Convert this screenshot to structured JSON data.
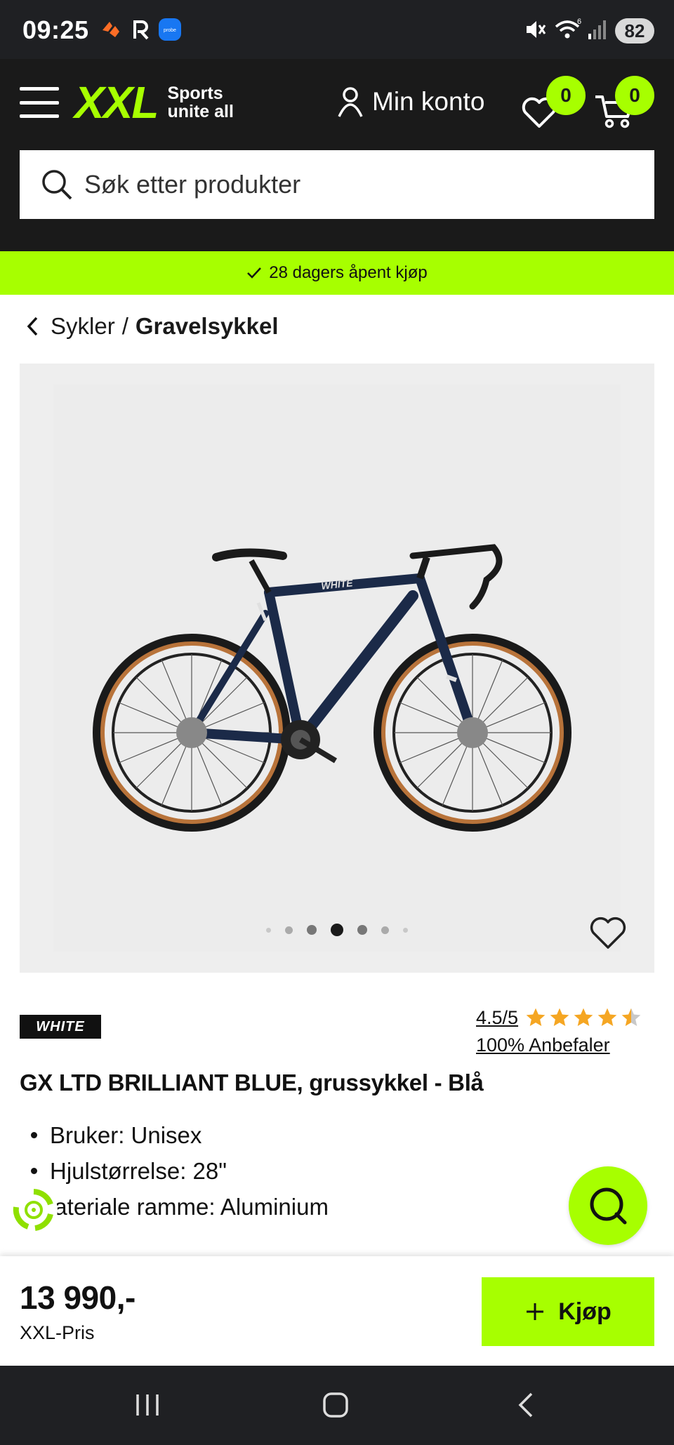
{
  "status_bar": {
    "time": "09:25",
    "battery": "82",
    "notification_icons": [
      "strava-icon",
      "r-app-icon",
      "probe-app-icon"
    ],
    "system_icons": [
      "mute-icon",
      "wifi-icon",
      "signal-icon"
    ],
    "wifi_label": "6"
  },
  "header": {
    "logo_text": "XXL",
    "tagline_line1": "Sports",
    "tagline_line2": "unite all",
    "account_label": "Min konto",
    "wishlist_count": "0",
    "cart_count": "0",
    "search_placeholder": "Søk etter produkter"
  },
  "promo": {
    "text": "28 dagers åpent kjøp"
  },
  "breadcrumb": {
    "parent": "Sykler",
    "separator": "/",
    "current": "Gravelsykkel"
  },
  "gallery": {
    "image_count": 7,
    "active_index": 3
  },
  "product": {
    "brand": "WHITE",
    "rating_text": "4.5/5",
    "rating_value": 4.5,
    "recommend_text": "100% Anbefaler",
    "title": "GX LTD BRILLIANT BLUE, grussykkel - Blå",
    "specs": [
      "Bruker: Unisex",
      "Hjulstørrelse: 28\"",
      "'ateriale ramme: Aluminium"
    ]
  },
  "buy_bar": {
    "price": "13 990,-",
    "price_label": "XXL-Pris",
    "buy_label": "Kjøp"
  },
  "colors": {
    "brand_green": "#a7ff00",
    "header_bg": "#1a1a1a",
    "star": "#f5a623"
  }
}
